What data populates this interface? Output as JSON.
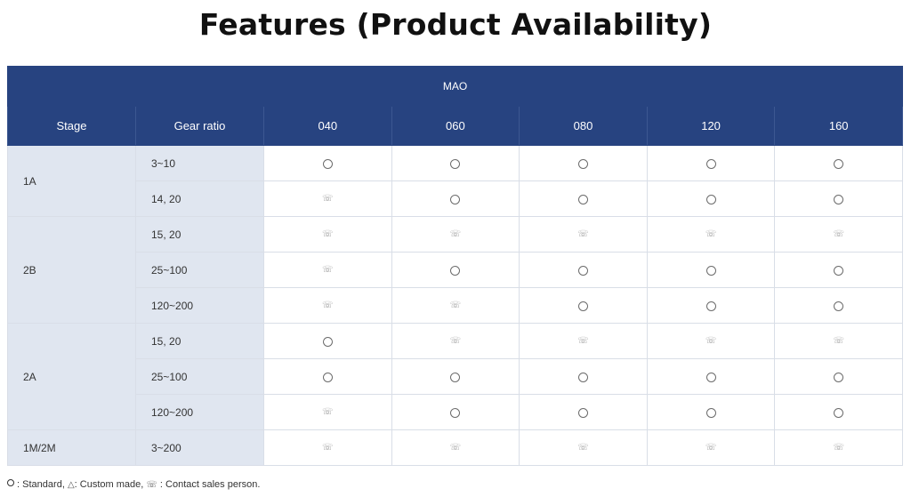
{
  "title": "Features (Product Availability)",
  "table": {
    "group_header": "MAO",
    "col_headers": [
      "Stage",
      "Gear ratio",
      "040",
      "060",
      "080",
      "120",
      "160"
    ],
    "groups": [
      {
        "stage": "1A",
        "rows": [
          {
            "ratio": "3~10",
            "marks": [
              "standard",
              "standard",
              "standard",
              "standard",
              "standard"
            ]
          },
          {
            "ratio": "14, 20",
            "marks": [
              "contact",
              "standard",
              "standard",
              "standard",
              "standard"
            ]
          }
        ]
      },
      {
        "stage": "2B",
        "rows": [
          {
            "ratio": "15, 20",
            "marks": [
              "contact",
              "contact",
              "contact",
              "contact",
              "contact"
            ]
          },
          {
            "ratio": "25~100",
            "marks": [
              "contact",
              "standard",
              "standard",
              "standard",
              "standard"
            ]
          },
          {
            "ratio": "120~200",
            "marks": [
              "contact",
              "contact",
              "standard",
              "standard",
              "standard"
            ]
          }
        ]
      },
      {
        "stage": "2A",
        "rows": [
          {
            "ratio": "15, 20",
            "marks": [
              "standard",
              "contact",
              "contact",
              "contact",
              "contact"
            ]
          },
          {
            "ratio": "25~100",
            "marks": [
              "standard",
              "standard",
              "standard",
              "standard",
              "standard"
            ]
          },
          {
            "ratio": "120~200",
            "marks": [
              "contact",
              "standard",
              "standard",
              "standard",
              "standard"
            ]
          }
        ]
      },
      {
        "stage": "1M/2M",
        "rows": [
          {
            "ratio": "3~200",
            "marks": [
              "contact",
              "contact",
              "contact",
              "contact",
              "contact"
            ]
          }
        ]
      }
    ]
  },
  "symbols": {
    "standard": "○",
    "custom": "△",
    "contact": "☏"
  },
  "legend": {
    "standard_text": " : Standard, ",
    "custom_text": ": Custom made, ",
    "contact_text": " : Contact sales person."
  },
  "colors": {
    "header_bg": "#274380",
    "label_cell_bg": "#e0e6f0",
    "border": "#d9dee7"
  }
}
